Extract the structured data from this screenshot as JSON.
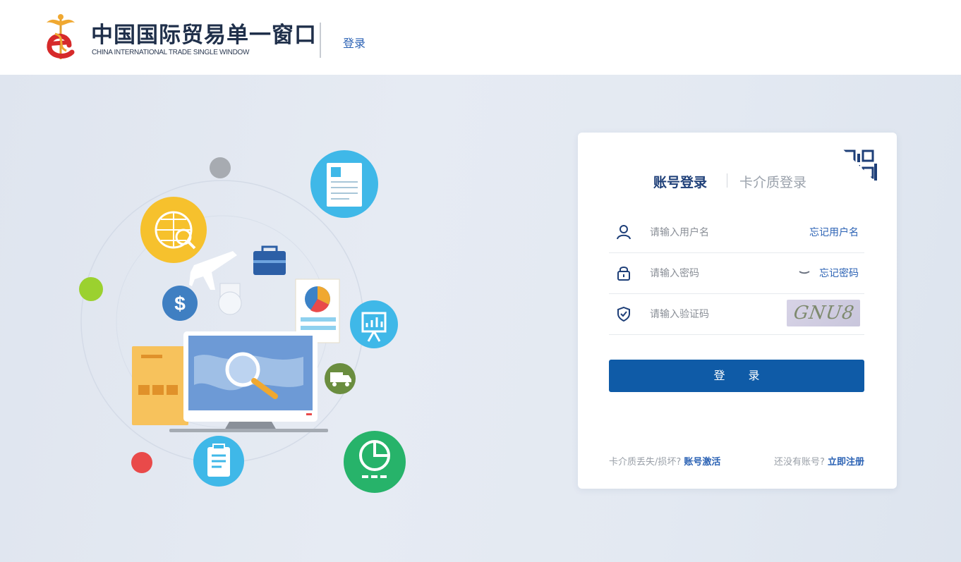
{
  "header": {
    "logo_cn": "中国国际贸易单一窗口",
    "logo_en": "CHINA INTERNATIONAL TRADE SINGLE WINDOW",
    "nav_login": "登录"
  },
  "login": {
    "tab_account": "账号登录",
    "tab_card": "卡介质登录",
    "username_placeholder": "请输入用户名",
    "forgot_username": "忘记用户名",
    "password_placeholder": "请输入密码",
    "forgot_password": "忘记密码",
    "captcha_placeholder": "请输入验证码",
    "captcha_text": "GNU8",
    "submit_label": "登 录",
    "card_lost_text": "卡介质丢失/损坏?",
    "account_activate": "账号激活",
    "no_account_text": "还没有账号?",
    "register_now": "立即注册"
  },
  "colors": {
    "primary": "#0f5ba7",
    "link": "#2b62b4",
    "background": "#e4e9f2"
  }
}
